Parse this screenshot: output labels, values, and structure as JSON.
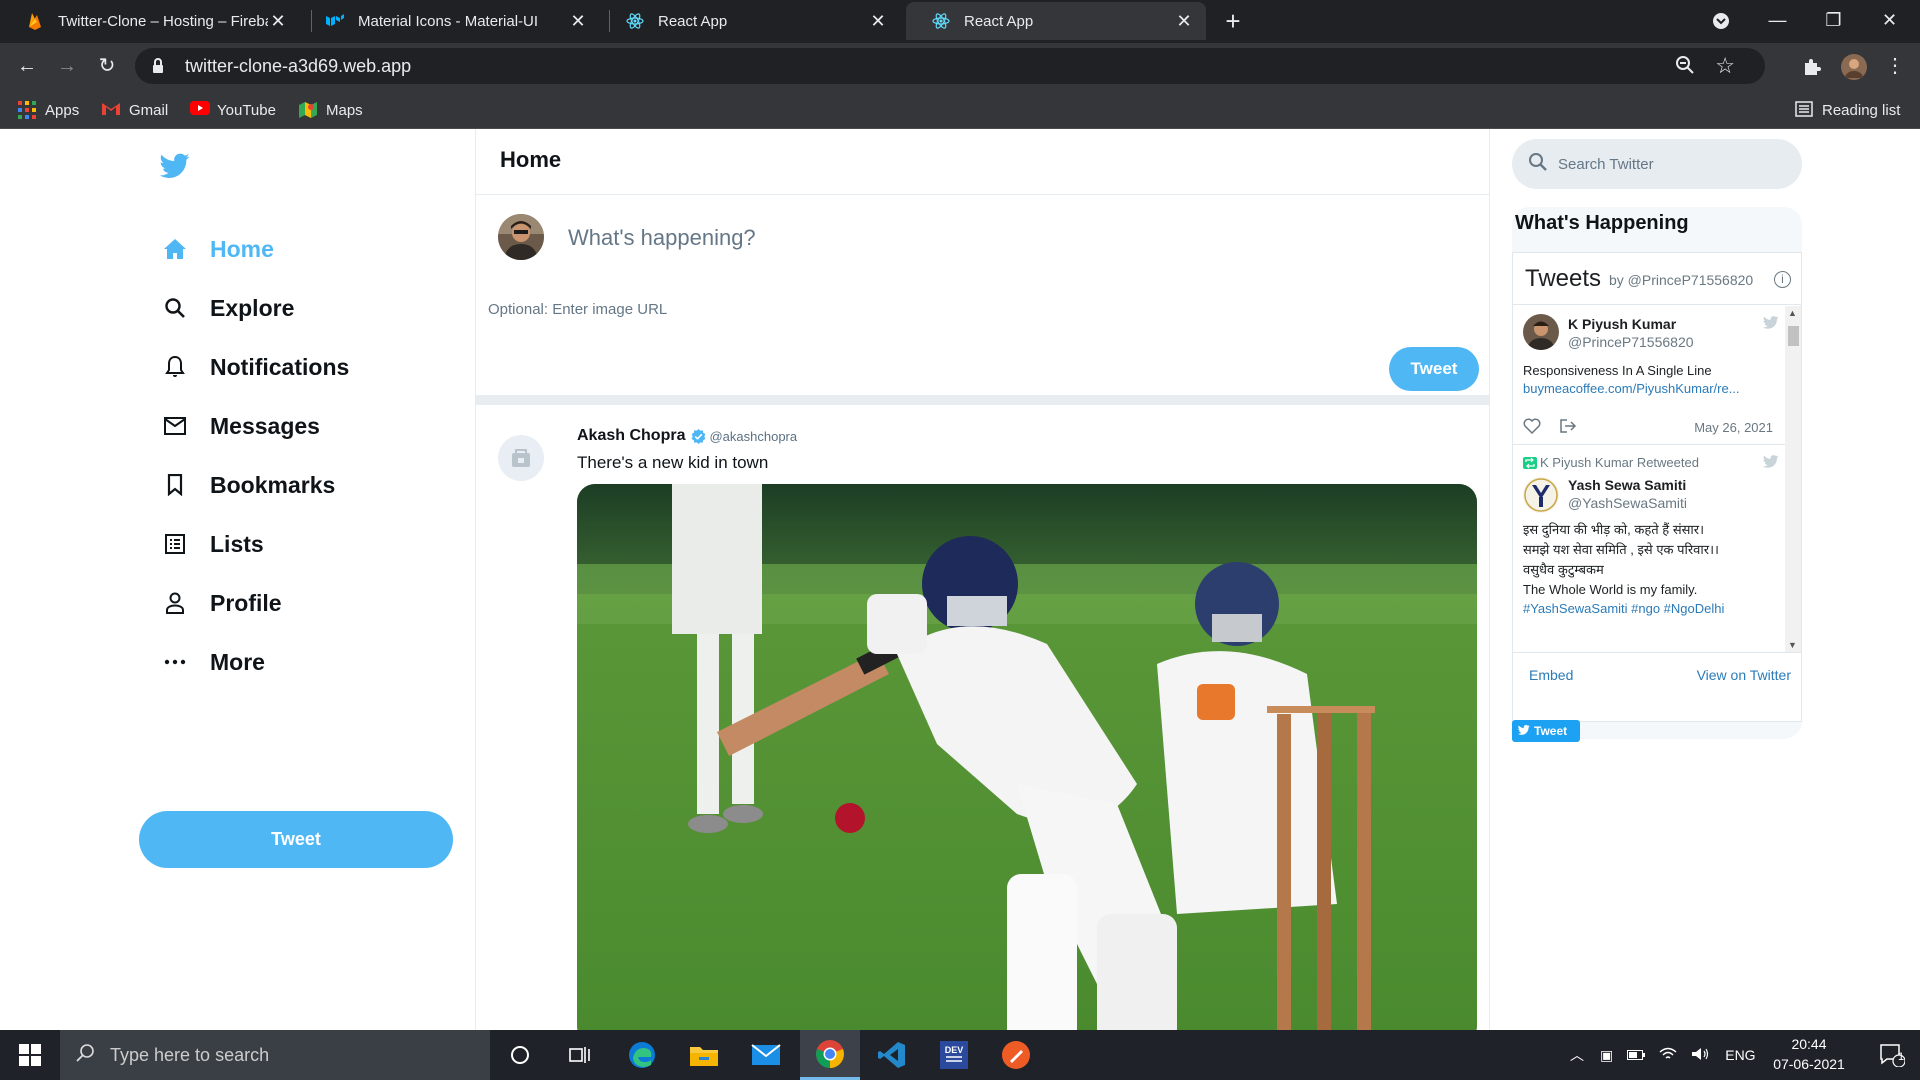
{
  "browser": {
    "tabs": [
      {
        "title": "Twitter-Clone – Hosting – Firebase"
      },
      {
        "title": "Material Icons - Material-UI"
      },
      {
        "title": "React App"
      },
      {
        "title": "React App"
      }
    ],
    "url": "twitter-clone-a3d69.web.app",
    "bookmarks": [
      "Apps",
      "Gmail",
      "YouTube",
      "Maps"
    ],
    "reading_list": "Reading list"
  },
  "sidebar": {
    "items": [
      {
        "label": "Home",
        "icon": "home-icon"
      },
      {
        "label": "Explore",
        "icon": "search-icon"
      },
      {
        "label": "Notifications",
        "icon": "bell-icon"
      },
      {
        "label": "Messages",
        "icon": "mail-icon"
      },
      {
        "label": "Bookmarks",
        "icon": "bookmark-icon"
      },
      {
        "label": "Lists",
        "icon": "list-icon"
      },
      {
        "label": "Profile",
        "icon": "person-icon"
      },
      {
        "label": "More",
        "icon": "more-icon"
      }
    ],
    "tweet_button": "Tweet",
    "accent": "#50b7f5"
  },
  "feed": {
    "header": "Home",
    "tweetbox": {
      "placeholder": "What's happening?",
      "image_placeholder": "Optional: Enter image URL",
      "button": "Tweet"
    },
    "post": {
      "name": "Akash Chopra",
      "handle": "@akashchopra",
      "text": "There's a new kid in town"
    }
  },
  "widgets": {
    "search_placeholder": "Search Twitter",
    "title": "What's Happening",
    "embed": {
      "title": "Tweets",
      "by": "by @PrinceP71556820",
      "tweets": [
        {
          "name": "K Piyush Kumar",
          "handle": "@PrinceP71556820",
          "text": "Responsiveness In A Single Line",
          "link": "buymeacoffee.com/PiyushKumar/re...",
          "date": "May 26, 2021"
        },
        {
          "retweet_by": "K Piyush Kumar Retweeted",
          "name": "Yash Sewa Samiti",
          "handle": "@YashSewaSamiti",
          "text_lines": [
            "इस दुनिया की भीड़ को, कहते हैं संसार।",
            "समझे यश सेवा समिति , इसे एक परिवार।।",
            "वसुधैव कुटुम्बकम",
            "The Whole World is my family."
          ],
          "link": "#YashSewaSamiti #ngo #NgoDelhi"
        }
      ],
      "footer_embed": "Embed",
      "footer_view": "View on Twitter",
      "share_button": "Tweet"
    }
  },
  "taskbar": {
    "search_placeholder": "Type here to search",
    "lang": "ENG",
    "time": "20:44",
    "date": "07-06-2021",
    "notification_count": "1"
  }
}
